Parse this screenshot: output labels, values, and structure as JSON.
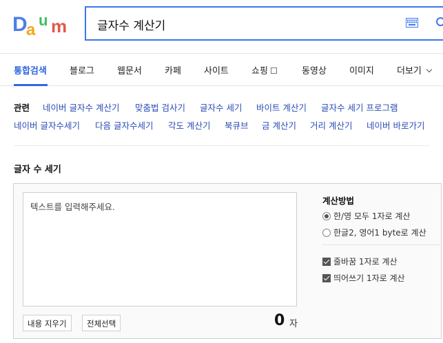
{
  "header": {
    "logo_letters": [
      "D",
      "a",
      "u",
      "m"
    ],
    "logo_colors": [
      "#4d80e6",
      "#f2a71d",
      "#46b965",
      "#e1574c"
    ],
    "search_query": "글자수 계산기",
    "icons": {
      "keyboard": "keyboard-icon",
      "search": "search-icon"
    }
  },
  "tabs": {
    "items": [
      "통합검색",
      "블로그",
      "웹문서",
      "카페",
      "사이트",
      "쇼핑",
      "동영상",
      "이미지",
      "더보기"
    ],
    "active_index": 0
  },
  "related": {
    "heading": "관련",
    "row1": [
      "네이버 글자수 계산기",
      "맞춤법 검사기",
      "글자수 세기",
      "바이트 계산기",
      "글자수 세기 프로그램"
    ],
    "row2": [
      "네이버 글자수세기",
      "다음 글자수세기",
      "각도 계산기",
      "북큐브",
      "금 계산기",
      "거리 계산기",
      "네이버 바로가기"
    ]
  },
  "counter": {
    "title": "글자 수 세기",
    "placeholder": "텍스트를 입력해주세요.",
    "clear_button": "내용 지우기",
    "select_all_button": "전체선택",
    "count": "0",
    "unit": "자",
    "method_title": "계산방법",
    "options_radio": [
      {
        "label": "한/영 모두 1자로 계산",
        "checked": true
      },
      {
        "label": "한글2, 영어1 byte로 계산",
        "checked": false
      }
    ],
    "options_check": [
      {
        "label": "줄바꿈 1자로 계산",
        "checked": true
      },
      {
        "label": "띄어쓰기 1자로 계산",
        "checked": true
      }
    ]
  }
}
